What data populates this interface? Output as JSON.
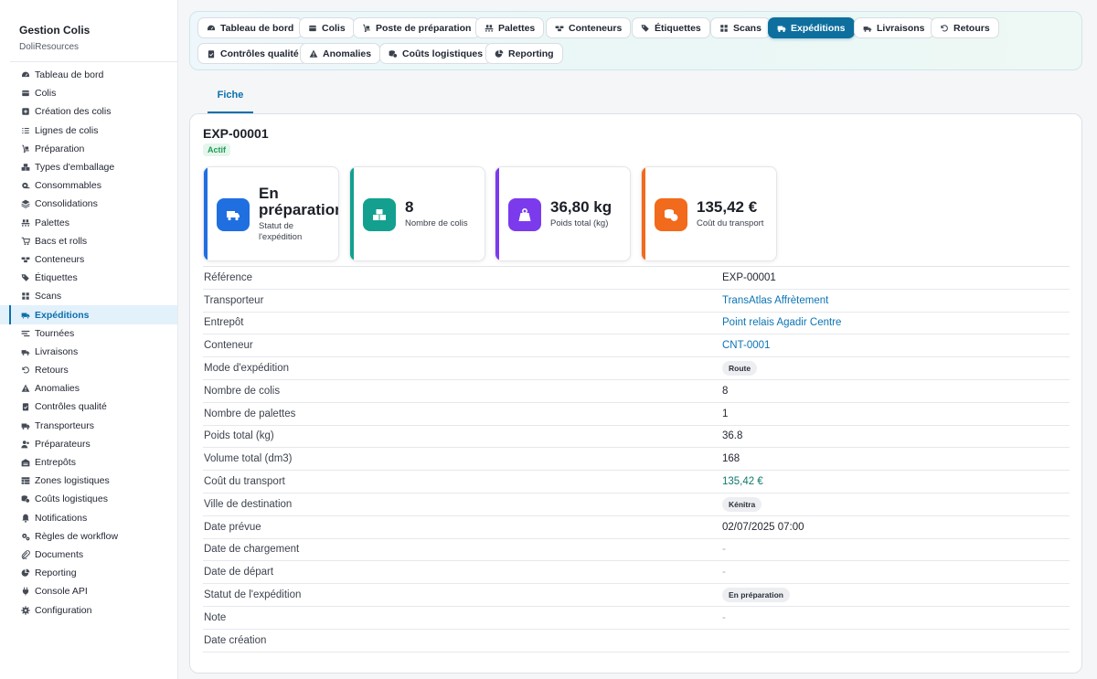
{
  "sidebar": {
    "title": "Gestion Colis",
    "subtitle": "DoliResources",
    "items": [
      {
        "label": "Tableau de bord",
        "icon": "dashboard-icon"
      },
      {
        "label": "Colis",
        "icon": "box-icon"
      },
      {
        "label": "Création des colis",
        "icon": "plus-square-icon"
      },
      {
        "label": "Lignes de colis",
        "icon": "list-icon"
      },
      {
        "label": "Préparation",
        "icon": "dolly-icon"
      },
      {
        "label": "Types d'emballage",
        "icon": "boxes-icon"
      },
      {
        "label": "Consommables",
        "icon": "tape-icon"
      },
      {
        "label": "Consolidations",
        "icon": "layers-icon"
      },
      {
        "label": "Palettes",
        "icon": "pallet-icon"
      },
      {
        "label": "Bacs et rolls",
        "icon": "cart-icon"
      },
      {
        "label": "Conteneurs",
        "icon": "container-icon"
      },
      {
        "label": "Étiquettes",
        "icon": "tags-icon"
      },
      {
        "label": "Scans",
        "icon": "grid-icon"
      },
      {
        "label": "Expéditions",
        "icon": "shipping-truck-icon",
        "active": true
      },
      {
        "label": "Tournées",
        "icon": "route-icon"
      },
      {
        "label": "Livraisons",
        "icon": "delivery-icon"
      },
      {
        "label": "Retours",
        "icon": "undo-icon"
      },
      {
        "label": "Anomalies",
        "icon": "warning-icon"
      },
      {
        "label": "Contrôles qualité",
        "icon": "clipboard-check-icon"
      },
      {
        "label": "Transporteurs",
        "icon": "truck-icon"
      },
      {
        "label": "Préparateurs",
        "icon": "users-icon"
      },
      {
        "label": "Entrepôts",
        "icon": "warehouse-icon"
      },
      {
        "label": "Zones logistiques",
        "icon": "table-icon"
      },
      {
        "label": "Coûts logistiques",
        "icon": "coins-icon"
      },
      {
        "label": "Notifications",
        "icon": "bell-icon"
      },
      {
        "label": "Règles de workflow",
        "icon": "cogs-icon"
      },
      {
        "label": "Documents",
        "icon": "paperclip-icon"
      },
      {
        "label": "Reporting",
        "icon": "pie-chart-icon"
      },
      {
        "label": "Console API",
        "icon": "plug-icon"
      },
      {
        "label": "Configuration",
        "icon": "gear-icon"
      }
    ]
  },
  "topnav": {
    "tabs": [
      {
        "label": "Tableau de bord",
        "icon": "dashboard-icon"
      },
      {
        "label": "Colis",
        "icon": "box-icon"
      },
      {
        "label": "Poste de préparation",
        "icon": "dolly-icon"
      },
      {
        "label": "Palettes",
        "icon": "pallet-icon"
      },
      {
        "label": "Conteneurs",
        "icon": "container-icon"
      },
      {
        "label": "Étiquettes",
        "icon": "tags-icon"
      },
      {
        "label": "Scans",
        "icon": "grid-icon"
      },
      {
        "label": "Expéditions",
        "icon": "shipping-truck-icon",
        "active": true
      },
      {
        "label": "Livraisons",
        "icon": "delivery-icon"
      },
      {
        "label": "Retours",
        "icon": "undo-icon"
      },
      {
        "label": "Contrôles qualité",
        "icon": "clipboard-check-icon"
      },
      {
        "label": "Anomalies",
        "icon": "warning-icon"
      },
      {
        "label": "Coûts logistiques",
        "icon": "coins-icon"
      },
      {
        "label": "Reporting",
        "icon": "pie-chart-icon"
      }
    ]
  },
  "subtabs": {
    "fiche": "Fiche"
  },
  "record": {
    "reference": "EXP-00001",
    "status": "Actif"
  },
  "kpis": [
    {
      "value": "En préparation",
      "label": "Statut de l'expédition",
      "icon": "truck-icon",
      "color": "#1f6fe0"
    },
    {
      "value": "8",
      "label": "Nombre de colis",
      "icon": "boxes-icon",
      "color": "#13a08f"
    },
    {
      "value": "36,80 kg",
      "label": "Poids total (kg)",
      "icon": "weight-icon",
      "color": "#7c3aed"
    },
    {
      "value": "135,42 €",
      "label": "Coût du transport",
      "icon": "coins-icon",
      "color": "#f26a1b"
    }
  ],
  "details": [
    {
      "label": "Référence",
      "value": "EXP-00001",
      "style": "text"
    },
    {
      "label": "Transporteur",
      "value": "TransAtlas Affrètement",
      "style": "link"
    },
    {
      "label": "Entrepôt",
      "value": "Point relais Agadir Centre",
      "style": "link"
    },
    {
      "label": "Conteneur",
      "value": "CNT-0001",
      "style": "link"
    },
    {
      "label": "Mode d'expédition",
      "value": "Route",
      "style": "pill"
    },
    {
      "label": "Nombre de colis",
      "value": "8",
      "style": "text"
    },
    {
      "label": "Nombre de palettes",
      "value": "1",
      "style": "text"
    },
    {
      "label": "Poids total (kg)",
      "value": "36.8",
      "style": "text"
    },
    {
      "label": "Volume total (dm3)",
      "value": "168",
      "style": "text"
    },
    {
      "label": "Coût du transport",
      "value": "135,42 €",
      "style": "money"
    },
    {
      "label": "Ville de destination",
      "value": "Kénitra",
      "style": "pill"
    },
    {
      "label": "Date prévue",
      "value": "02/07/2025 07:00",
      "style": "text"
    },
    {
      "label": "Date de chargement",
      "value": "-",
      "style": "muted"
    },
    {
      "label": "Date de départ",
      "value": "-",
      "style": "muted"
    },
    {
      "label": "Statut de l'expédition",
      "value": "En préparation",
      "style": "pill"
    },
    {
      "label": "Note",
      "value": "-",
      "style": "muted"
    },
    {
      "label": "Date création",
      "value": "",
      "style": "text"
    }
  ]
}
